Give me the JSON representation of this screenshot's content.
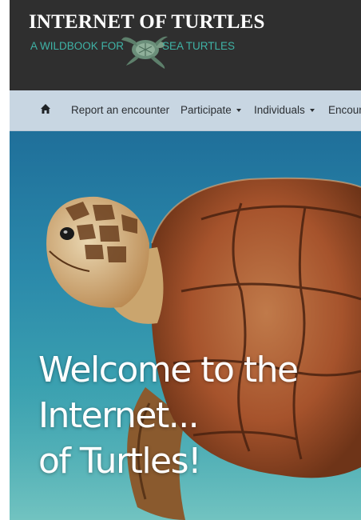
{
  "header": {
    "title": "INTERNET OF TURTLES",
    "subtitle_left": "A WILDBOOK FOR",
    "subtitle_right": "SEA TURTLES",
    "logo_icon": "sea-turtle-logo"
  },
  "nav": {
    "home_icon": "home-icon",
    "items": [
      {
        "label": "Report an encounter",
        "dropdown": false
      },
      {
        "label": "Participate",
        "dropdown": true
      },
      {
        "label": "Individuals",
        "dropdown": true
      },
      {
        "label": "Encoun",
        "dropdown": false
      }
    ]
  },
  "hero": {
    "lines": [
      "Welcome to the",
      "Internet...",
      "of Turtles!"
    ]
  },
  "colors": {
    "header_bg": "#2f2f2f",
    "accent": "#3fb3a6",
    "navbar_bg": "#c8d6e2",
    "water": "#2a88aa",
    "shell": "#a6532c"
  }
}
